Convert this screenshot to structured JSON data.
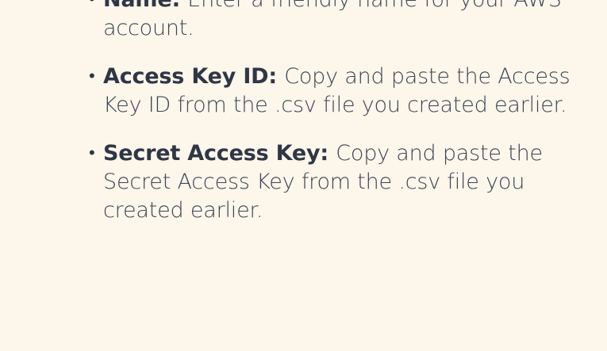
{
  "items": [
    {
      "bullet": "•",
      "term": "Name:",
      "description": "Enter a friendly name for your AWS account."
    },
    {
      "bullet": "•",
      "term": "Access Key ID:",
      "description": "Copy and paste the Access Key ID from the .csv file you created earlier."
    },
    {
      "bullet": "•",
      "term": "Secret Access Key:",
      "description": "Copy and paste the Secret Access Key from the .csv file you created earlier."
    }
  ]
}
